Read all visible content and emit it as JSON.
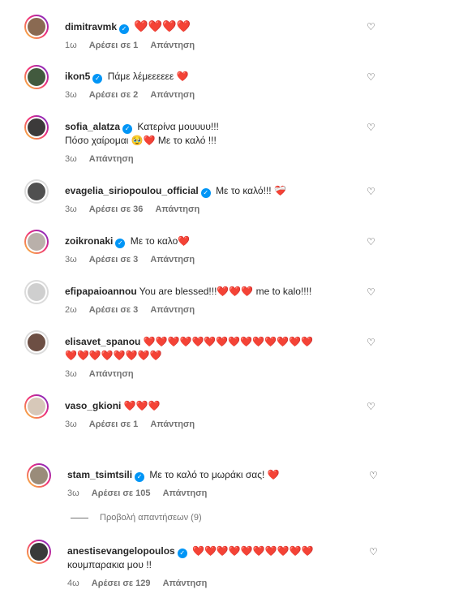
{
  "comments": [
    {
      "username": "dimitravmk",
      "verified": true,
      "text": "❤️❤️❤️❤️",
      "time": "1ω",
      "likes": "Αρέσει σε 1",
      "reply": "Απάντηση",
      "avatar_color": "#8a6a52"
    },
    {
      "username": "ikon5",
      "verified": true,
      "text": "Πάμε λέμεεεεεε ❤️",
      "time": "3ω",
      "likes": "Αρέσει σε 2",
      "reply": "Απάντηση",
      "avatar_color": "#425a3e"
    },
    {
      "username": "sofia_alatza",
      "verified": true,
      "text": "Κατερίνα μουυυυ!!!\nΠόσο χαίρομαι 🥹❤️ Με το καλό !!!",
      "time": "3ω",
      "likes": "",
      "reply": "Απάντηση",
      "avatar_color": "#3c3a3a"
    },
    {
      "username": "evagelia_siriopoulou_official",
      "verified": true,
      "text": "Με το καλό!!! ❤️‍🩹",
      "time": "3ω",
      "likes": "Αρέσει σε 36",
      "reply": "Απάντηση",
      "avatar_color": "#505050"
    },
    {
      "username": "zoikronaki",
      "verified": true,
      "text": "Με το καλο❤️",
      "time": "3ω",
      "likes": "Αρέσει σε 3",
      "reply": "Απάντηση",
      "avatar_color": "#b9b0aa"
    },
    {
      "username": "efipapaioannou",
      "verified": false,
      "text": "You are blessed!!!❤️❤️❤️ me to kalo!!!!",
      "time": "2ω",
      "likes": "Αρέσει σε 3",
      "reply": "Απάντηση",
      "avatar_color": "#cfcfcf"
    },
    {
      "username": "elisavet_spanou",
      "verified": false,
      "text": "❤️❤️❤️❤️❤️❤️❤️❤️❤️❤️❤️❤️❤️❤️\n❤️❤️❤️❤️❤️❤️❤️❤️",
      "time": "3ω",
      "likes": "",
      "reply": "Απάντηση",
      "avatar_color": "#6d4f44"
    },
    {
      "username": "vaso_gkioni",
      "verified": false,
      "text": "❤️❤️❤️",
      "time": "3ω",
      "likes": "Αρέσει σε 1",
      "reply": "Απάντηση",
      "avatar_color": "#d7c8b9"
    },
    {
      "username": "stam_tsimtsili",
      "verified": true,
      "text": "Με το καλό το μωράκι σας! ❤️",
      "time": "3ω",
      "likes": "Αρέσει σε 105",
      "reply": "Απάντηση",
      "avatar_color": "#9a8c7a"
    },
    {
      "username": "anestisevangelopoulos",
      "verified": true,
      "text": "❤️❤️❤️❤️❤️❤️❤️❤️❤️❤️\nκουμπαρακια μου !!",
      "time": "4ω",
      "likes": "Αρέσει σε 129",
      "reply": "Απάντηση",
      "avatar_color": "#3a3a3a"
    }
  ],
  "view_replies": "Προβολή απαντήσεων (9)",
  "icons": {
    "like": "heart-outline-icon",
    "verified": "verified-badge-icon"
  },
  "colors": {
    "heart": "#ed2f47",
    "verified": "#0095f6",
    "meta": "#737373"
  }
}
